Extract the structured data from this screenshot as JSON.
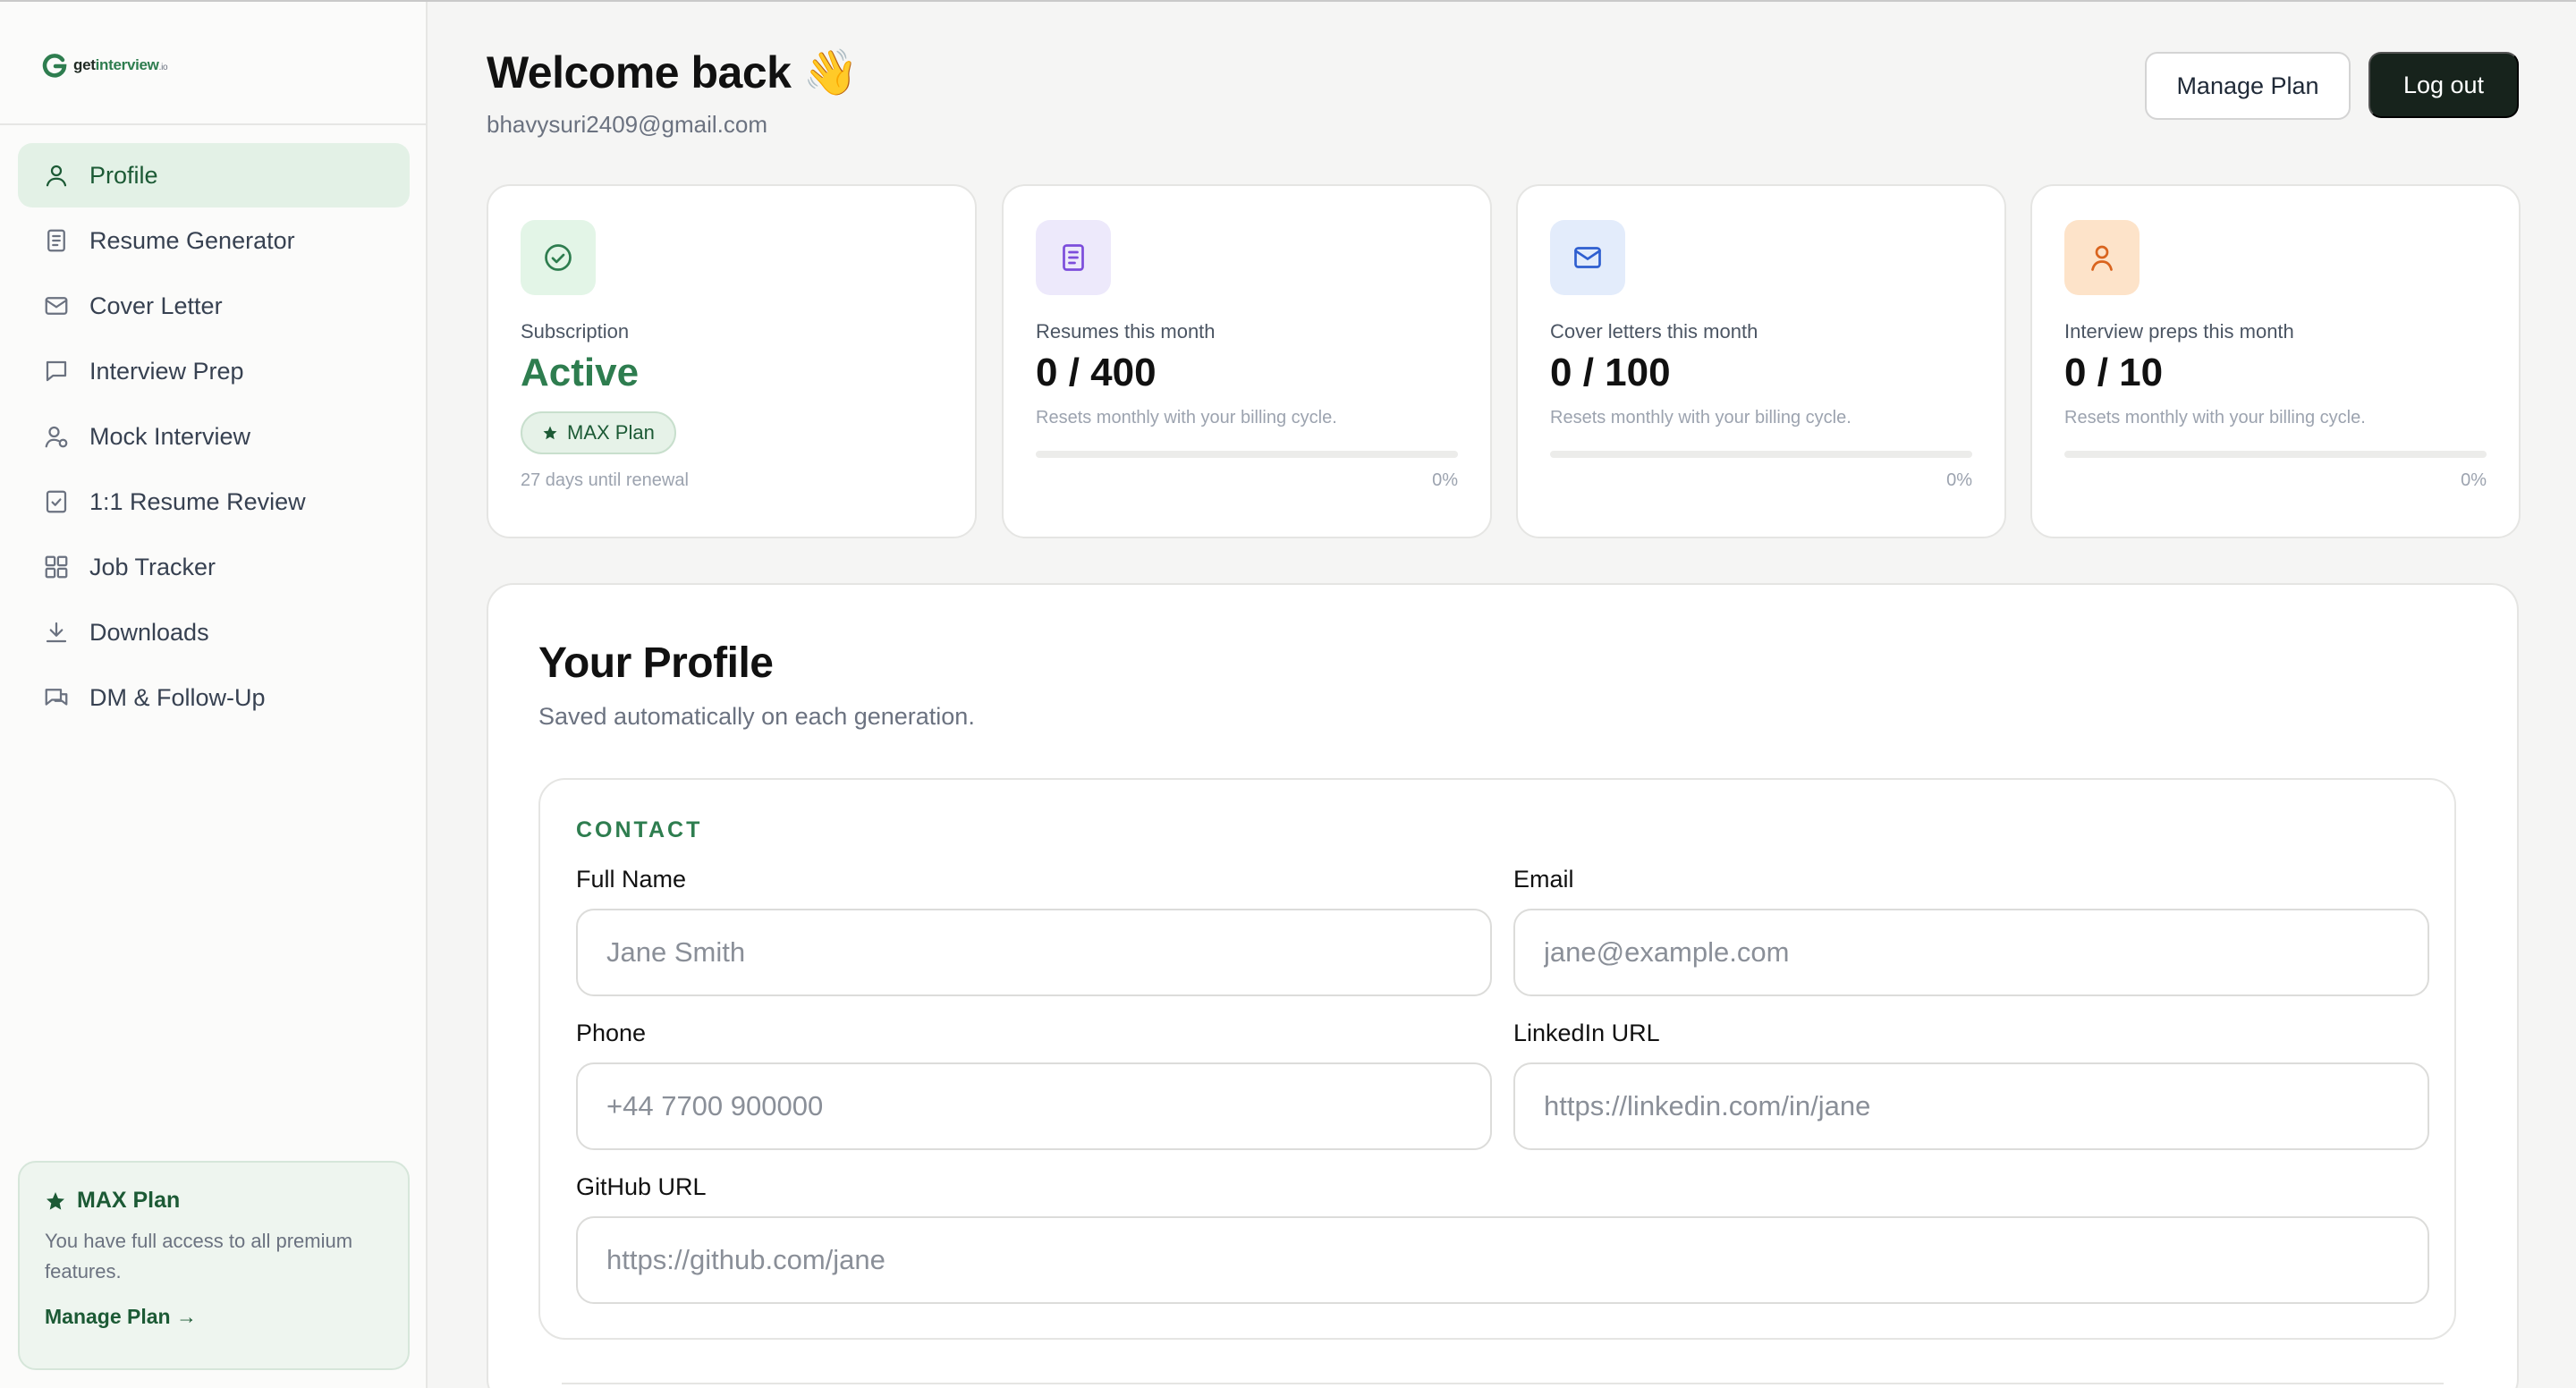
{
  "brand": {
    "prefix": "get",
    "accent": "interview",
    "tld": ".io"
  },
  "sidebar": {
    "items": [
      {
        "label": "Profile",
        "icon": "user-icon",
        "active": true
      },
      {
        "label": "Resume Generator",
        "icon": "document-icon"
      },
      {
        "label": "Cover Letter",
        "icon": "mail-icon"
      },
      {
        "label": "Interview Prep",
        "icon": "message-icon"
      },
      {
        "label": "Mock Interview",
        "icon": "user-mic-icon"
      },
      {
        "label": "1:1 Resume Review",
        "icon": "check-square-icon"
      },
      {
        "label": "Job Tracker",
        "icon": "grid-icon"
      },
      {
        "label": "Downloads",
        "icon": "download-icon"
      },
      {
        "label": "DM & Follow-Up",
        "icon": "chat-icon"
      }
    ],
    "plan": {
      "title": "MAX Plan",
      "description": "You have full access to all premium features.",
      "link": "Manage Plan →"
    }
  },
  "header": {
    "welcome": "Welcome back 👋",
    "email": "bhavysuri2409@gmail.com",
    "manage_plan": "Manage Plan",
    "logout": "Log out"
  },
  "stats": {
    "subscription": {
      "label": "Subscription",
      "value": "Active",
      "badge": "MAX Plan",
      "renewal": "27 days until renewal"
    },
    "resumes": {
      "label": "Resumes this month",
      "value": "0 / 400",
      "note": "Resets monthly with your billing cycle.",
      "pct": "0%",
      "progress": 0
    },
    "cover_letters": {
      "label": "Cover letters this month",
      "value": "0 / 100",
      "note": "Resets monthly with your billing cycle.",
      "pct": "0%",
      "progress": 0
    },
    "interview_preps": {
      "label": "Interview preps this month",
      "value": "0 / 10",
      "note": "Resets monthly with your billing cycle.",
      "pct": "0%",
      "progress": 0
    }
  },
  "profile": {
    "title": "Your Profile",
    "subtitle": "Saved automatically on each generation.",
    "section": "CONTACT",
    "fields": {
      "full_name": {
        "label": "Full Name",
        "placeholder": "Jane Smith",
        "value": ""
      },
      "email": {
        "label": "Email",
        "placeholder": "jane@example.com",
        "value": ""
      },
      "phone": {
        "label": "Phone",
        "placeholder": "+44 7700 900000",
        "value": ""
      },
      "linkedin": {
        "label": "LinkedIn URL",
        "placeholder": "https://linkedin.com/in/jane",
        "value": ""
      },
      "github": {
        "label": "GitHub URL",
        "placeholder": "https://github.com/jane",
        "value": ""
      }
    }
  },
  "colors": {
    "brand_green": "#2e7d4f",
    "active_nav_bg": "#e3f1e6",
    "dark_button": "#17231c",
    "subscription_icon_bg": "#e3f5e7",
    "resumes_icon_bg": "#ede9fb",
    "cover_icon_bg": "#e3ecfb",
    "interview_icon_bg": "#fde3c9"
  }
}
